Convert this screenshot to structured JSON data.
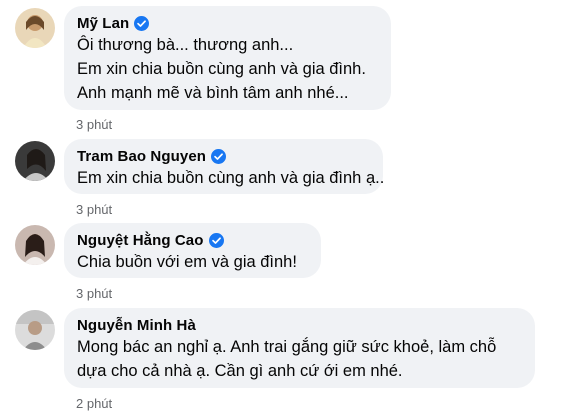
{
  "comments": [
    {
      "author": "Mỹ Lan",
      "verified": true,
      "avatar_icon": "profile-photo",
      "lines": [
        "Ôi thương bà... thương anh...",
        "Em xin chia buồn cùng anh và gia đình.",
        "Anh mạnh mẽ và bình tâm anh nhé..."
      ],
      "time": "3 phút"
    },
    {
      "author": "Tram Bao Nguyen",
      "verified": true,
      "avatar_icon": "profile-photo",
      "lines": [
        "Em xin chia buồn cùng anh và gia đình ạ.."
      ],
      "time": "3 phút"
    },
    {
      "author": "Nguyệt Hằng Cao",
      "verified": true,
      "avatar_icon": "profile-photo",
      "lines": [
        "Chia buồn với em và gia đình!"
      ],
      "time": "3 phút"
    },
    {
      "author": "Nguyễn Minh Hà",
      "verified": false,
      "avatar_icon": "profile-photo",
      "lines": [
        "Mong bác an nghỉ ạ. Anh trai gắng giữ sức khoẻ, làm chỗ",
        "dựa cho cả nhà ạ. Cần gì anh cứ ới em nhé."
      ],
      "time": "2 phút"
    }
  ],
  "colors": {
    "bubble": "#f0f2f5",
    "text": "#050505",
    "meta": "#65676b",
    "verified": "#1877f2"
  }
}
